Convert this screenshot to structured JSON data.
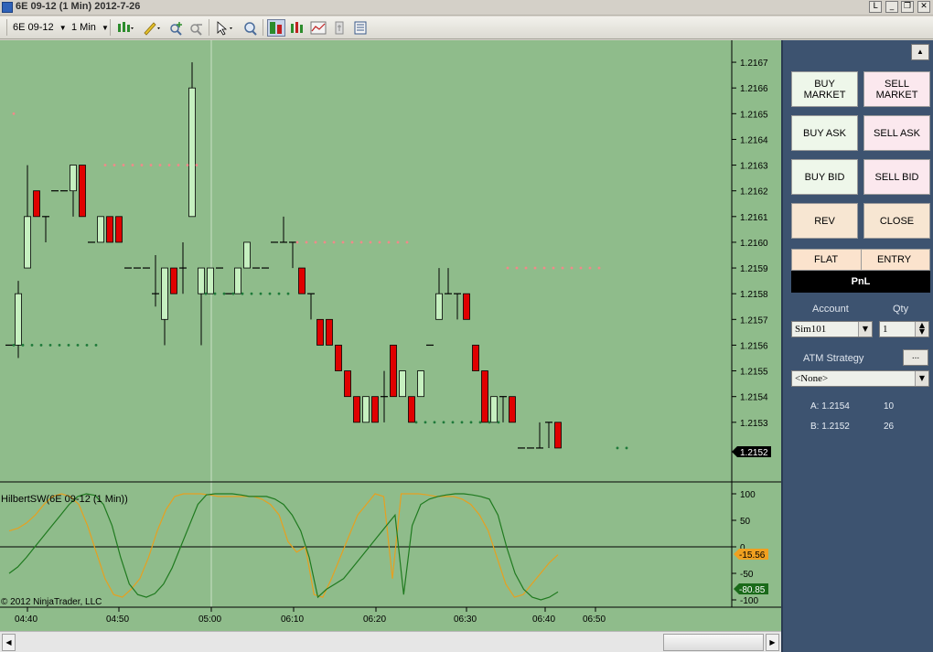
{
  "window": {
    "title": "6E 09-12 (1 Min)  2012-7-26",
    "buttons": [
      "L",
      "_",
      "❐",
      "✕"
    ]
  },
  "toolbar": {
    "instrument": "6E 09-12",
    "interval": "1 Min"
  },
  "chart": {
    "y_axis_labels": [
      "1.2167",
      "1.2166",
      "1.2165",
      "1.2164",
      "1.2163",
      "1.2162",
      "1.2161",
      "1.2160",
      "1.2159",
      "1.2158",
      "1.2157",
      "1.2156",
      "1.2155",
      "1.2154",
      "1.2153"
    ],
    "last_price_label": "1.2152",
    "indicator_title": "HilbertSW(6E 09-12 (1 Min))",
    "indicator_axis_labels": [
      "100",
      "50",
      "0",
      "-50",
      "-100"
    ],
    "indicator_values": [
      "-15.56",
      "-80.85"
    ],
    "copyright": "© 2012 NinjaTrader, LLC",
    "x_axis_labels": [
      "04:40",
      "04:50",
      "05:00",
      "06:10",
      "06:20",
      "06:30",
      "06:40",
      "06:50"
    ],
    "colors": {
      "background": "#8fbc8b",
      "up_candle": "#c6f0c0",
      "down_candle": "#e00000",
      "sine_line": "#1f7a1f",
      "lead_line": "#e6a020",
      "resistance_dots": "#f08a8a",
      "support_dots": "#1f7a3a"
    }
  },
  "chart_data": {
    "type": "candlestick",
    "price_panel": {
      "ylim": [
        1.21515,
        1.21675
      ],
      "candles": [
        {
          "o": 1.2156,
          "h": 1.2156,
          "l": 1.2156,
          "c": 1.2156
        },
        {
          "o": 1.2156,
          "h": 1.21585,
          "l": 1.21555,
          "c": 1.2158
        },
        {
          "o": 1.2159,
          "h": 1.2163,
          "l": 1.2159,
          "c": 1.2161
        },
        {
          "o": 1.2162,
          "h": 1.2162,
          "l": 1.2161,
          "c": 1.2161
        },
        {
          "o": 1.2161,
          "h": 1.2161,
          "l": 1.216,
          "c": 1.2161
        },
        {
          "o": 1.2162,
          "h": 1.2162,
          "l": 1.2162,
          "c": 1.2162
        },
        {
          "o": 1.2162,
          "h": 1.2162,
          "l": 1.2162,
          "c": 1.2162
        },
        {
          "o": 1.2162,
          "h": 1.2163,
          "l": 1.2161,
          "c": 1.2163
        },
        {
          "o": 1.2163,
          "h": 1.2163,
          "l": 1.2161,
          "c": 1.2161
        },
        {
          "o": 1.216,
          "h": 1.216,
          "l": 1.216,
          "c": 1.216
        },
        {
          "o": 1.216,
          "h": 1.2161,
          "l": 1.216,
          "c": 1.2161
        },
        {
          "o": 1.2161,
          "h": 1.2161,
          "l": 1.216,
          "c": 1.216
        },
        {
          "o": 1.2161,
          "h": 1.2161,
          "l": 1.216,
          "c": 1.216
        },
        {
          "o": 1.2159,
          "h": 1.2159,
          "l": 1.2159,
          "c": 1.2159
        },
        {
          "o": 1.2159,
          "h": 1.2159,
          "l": 1.2159,
          "c": 1.2159
        },
        {
          "o": 1.2159,
          "h": 1.2159,
          "l": 1.2159,
          "c": 1.2159
        },
        {
          "o": 1.2158,
          "h": 1.21595,
          "l": 1.21575,
          "c": 1.2158
        },
        {
          "o": 1.2157,
          "h": 1.2159,
          "l": 1.2156,
          "c": 1.2159
        },
        {
          "o": 1.2159,
          "h": 1.2159,
          "l": 1.2158,
          "c": 1.2158
        },
        {
          "o": 1.2159,
          "h": 1.216,
          "l": 1.2158,
          "c": 1.2159
        },
        {
          "o": 1.2161,
          "h": 1.2167,
          "l": 1.2161,
          "c": 1.2166
        },
        {
          "o": 1.2158,
          "h": 1.2159,
          "l": 1.2156,
          "c": 1.2159
        },
        {
          "o": 1.2158,
          "h": 1.2159,
          "l": 1.2158,
          "c": 1.2159
        },
        {
          "o": 1.2159,
          "h": 1.2159,
          "l": 1.2159,
          "c": 1.2159
        },
        {
          "o": 1.2158,
          "h": 1.2158,
          "l": 1.2158,
          "c": 1.2158
        },
        {
          "o": 1.2158,
          "h": 1.2159,
          "l": 1.2158,
          "c": 1.2159
        },
        {
          "o": 1.2159,
          "h": 1.216,
          "l": 1.2159,
          "c": 1.216
        },
        {
          "o": 1.2159,
          "h": 1.2159,
          "l": 1.2159,
          "c": 1.2159
        },
        {
          "o": 1.2159,
          "h": 1.2159,
          "l": 1.2159,
          "c": 1.2159
        },
        {
          "o": 1.216,
          "h": 1.216,
          "l": 1.216,
          "c": 1.216
        },
        {
          "o": 1.216,
          "h": 1.2161,
          "l": 1.216,
          "c": 1.216
        },
        {
          "o": 1.216,
          "h": 1.216,
          "l": 1.2159,
          "c": 1.216
        },
        {
          "o": 1.2159,
          "h": 1.2159,
          "l": 1.2158,
          "c": 1.2158
        },
        {
          "o": 1.2158,
          "h": 1.2158,
          "l": 1.2157,
          "c": 1.2158
        },
        {
          "o": 1.2157,
          "h": 1.2157,
          "l": 1.2156,
          "c": 1.2156
        },
        {
          "o": 1.2157,
          "h": 1.2157,
          "l": 1.2156,
          "c": 1.2156
        },
        {
          "o": 1.2156,
          "h": 1.2156,
          "l": 1.2155,
          "c": 1.2155
        },
        {
          "o": 1.2155,
          "h": 1.2155,
          "l": 1.2154,
          "c": 1.2154
        },
        {
          "o": 1.2154,
          "h": 1.2154,
          "l": 1.2153,
          "c": 1.2153
        },
        {
          "o": 1.2153,
          "h": 1.2154,
          "l": 1.2153,
          "c": 1.2154
        },
        {
          "o": 1.2154,
          "h": 1.2154,
          "l": 1.2153,
          "c": 1.2153
        },
        {
          "o": 1.2154,
          "h": 1.2155,
          "l": 1.2153,
          "c": 1.2154
        },
        {
          "o": 1.2156,
          "h": 1.2156,
          "l": 1.2154,
          "c": 1.2154
        },
        {
          "o": 1.2154,
          "h": 1.2155,
          "l": 1.2154,
          "c": 1.2155
        },
        {
          "o": 1.2154,
          "h": 1.2154,
          "l": 1.2153,
          "c": 1.2153
        },
        {
          "o": 1.2154,
          "h": 1.2155,
          "l": 1.2154,
          "c": 1.2155
        },
        {
          "o": 1.2156,
          "h": 1.2156,
          "l": 1.2156,
          "c": 1.2156
        },
        {
          "o": 1.2157,
          "h": 1.2159,
          "l": 1.2157,
          "c": 1.2158
        },
        {
          "o": 1.2158,
          "h": 1.2159,
          "l": 1.2158,
          "c": 1.2158
        },
        {
          "o": 1.2158,
          "h": 1.2158,
          "l": 1.2157,
          "c": 1.2158
        },
        {
          "o": 1.2158,
          "h": 1.2158,
          "l": 1.2157,
          "c": 1.2157
        },
        {
          "o": 1.2156,
          "h": 1.2156,
          "l": 1.2155,
          "c": 1.2155
        },
        {
          "o": 1.2155,
          "h": 1.2155,
          "l": 1.2153,
          "c": 1.2153
        },
        {
          "o": 1.2153,
          "h": 1.2154,
          "l": 1.2153,
          "c": 1.2154
        },
        {
          "o": 1.2154,
          "h": 1.2154,
          "l": 1.2153,
          "c": 1.2154
        },
        {
          "o": 1.2154,
          "h": 1.2154,
          "l": 1.2153,
          "c": 1.2153
        },
        {
          "o": 1.2152,
          "h": 1.2152,
          "l": 1.2152,
          "c": 1.2152
        },
        {
          "o": 1.2152,
          "h": 1.2152,
          "l": 1.2152,
          "c": 1.2152
        },
        {
          "o": 1.2152,
          "h": 1.2153,
          "l": 1.2152,
          "c": 1.2152
        },
        {
          "o": 1.2153,
          "h": 1.2153,
          "l": 1.2152,
          "c": 1.2153
        },
        {
          "o": 1.2153,
          "h": 1.2153,
          "l": 1.2152,
          "c": 1.2152
        }
      ],
      "resistance_levels": [
        1.2165,
        1.2163,
        1.216,
        1.2159
      ],
      "support_levels": [
        1.2156,
        1.2158,
        1.2153,
        1.2152
      ],
      "last_price": 1.2152
    },
    "indicator_panel": {
      "ylim": [
        -100,
        100
      ],
      "sine": [
        -50,
        -38,
        -20,
        0,
        20,
        40,
        60,
        80,
        95,
        100,
        97,
        80,
        40,
        -20,
        -70,
        -90,
        -95,
        -88,
        -70,
        -40,
        0,
        40,
        80,
        98,
        100,
        100,
        100,
        98,
        95,
        95,
        95,
        90,
        80,
        60,
        30,
        -20,
        -95,
        -80,
        -70,
        -60,
        -40,
        -20,
        0,
        20,
        40,
        60,
        -90,
        40,
        80,
        90,
        95,
        98,
        100,
        100,
        98,
        95,
        90,
        60,
        0,
        -50,
        -80,
        -95,
        -100,
        -95,
        -85
      ],
      "lead": [
        30,
        35,
        45,
        60,
        80,
        95,
        100,
        95,
        80,
        40,
        -10,
        -60,
        -90,
        -95,
        -80,
        -60,
        -20,
        30,
        70,
        95,
        100,
        100,
        100,
        98,
        95,
        95,
        95,
        95,
        95,
        90,
        80,
        60,
        10,
        -10,
        0,
        -90,
        -95,
        -60,
        -20,
        20,
        60,
        80,
        100,
        95,
        -60,
        100,
        100,
        100,
        98,
        95,
        95,
        95,
        90,
        80,
        60,
        30,
        -20,
        -70,
        -95,
        -90,
        -70,
        -50,
        -30,
        -15
      ]
    }
  },
  "panel": {
    "buy_market": "BUY MARKET",
    "sell_market": "SELL MARKET",
    "buy_ask": "BUY ASK",
    "sell_ask": "SELL ASK",
    "buy_bid": "BUY BID",
    "sell_bid": "SELL BID",
    "rev": "REV",
    "close": "CLOSE",
    "flat": "FLAT",
    "entry": "ENTRY",
    "pnl": "PnL",
    "account_label": "Account",
    "qty_label": "Qty",
    "account_value": "Sim101",
    "qty_value": "1",
    "atm_label": "ATM Strategy",
    "atm_btn": "...",
    "atm_value": "<None>",
    "ask_label": "A: 1.2154",
    "ask_size": "10",
    "bid_label": "B: 1.2152",
    "bid_size": "26"
  }
}
